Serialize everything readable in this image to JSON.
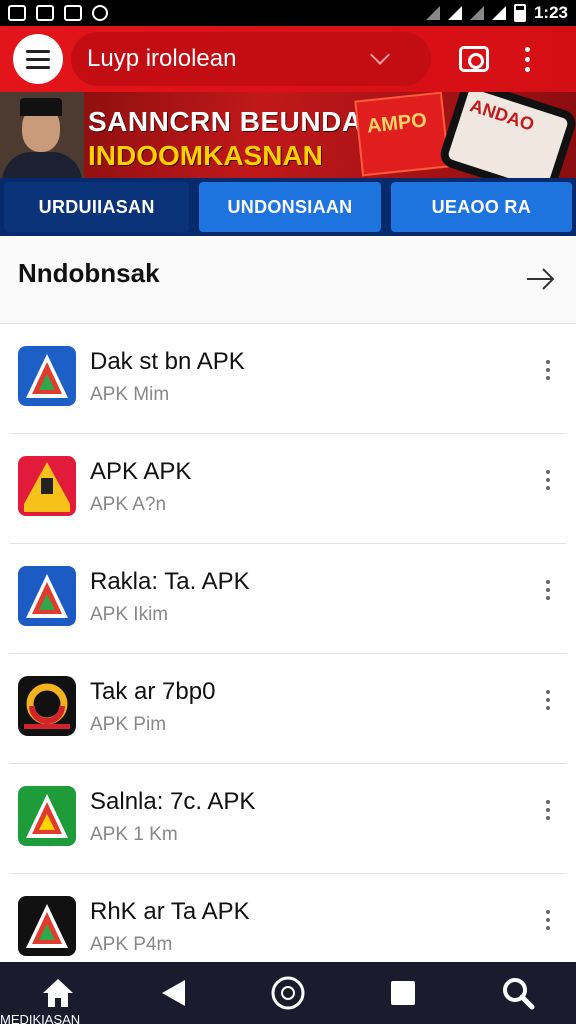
{
  "status_bar": {
    "time": "1:23"
  },
  "toolbar": {
    "search_text": "Luyp irololean"
  },
  "banner": {
    "headline": "SANNCRN BEUNDARI",
    "subline": "INDOOMKASNAN",
    "card_text": "AMPO",
    "phone_text": "ANDAO"
  },
  "tabs": [
    {
      "label": "URDUIIASAN"
    },
    {
      "label": "UNDONSIAAN"
    },
    {
      "label": "UEAOO RA"
    }
  ],
  "section": {
    "title": "Nndobnsak"
  },
  "apps": [
    {
      "name": "Dak st bn APK",
      "sub": "APK Mim",
      "icon": "a-triangle-icon",
      "colors": [
        "#1c5fc7",
        "#e23b2e",
        "#2ea84a"
      ]
    },
    {
      "name": "APK APK",
      "sub": "APK A?n",
      "icon": "warning-triangle-icon",
      "colors": [
        "#e31b3a",
        "#f6c21a",
        "#222222"
      ]
    },
    {
      "name": "Rakla: Ta. APK",
      "sub": "APK Ikim",
      "icon": "a-triangle-icon",
      "colors": [
        "#1d5bc4",
        "#e23b2e",
        "#2ea84a"
      ]
    },
    {
      "name": "Tak ar 7bp0",
      "sub": "APK Pim",
      "icon": "circle-logo-icon",
      "colors": [
        "#111111",
        "#f4b21c",
        "#d2232a"
      ]
    },
    {
      "name": "Salnla: 7c. APK",
      "sub": "APK 1 Km",
      "icon": "a-triangle-icon",
      "colors": [
        "#1e9c3a",
        "#e23b2e",
        "#ffd200"
      ]
    },
    {
      "name": "RhK ar Ta APK",
      "sub": "APK P4m",
      "icon": "a-triangle-icon",
      "colors": [
        "#111111",
        "#e23b2e",
        "#2ea84a"
      ]
    }
  ],
  "bottom_nav": {
    "home_label": "MEDIKIASAN",
    "items": [
      "home-icon",
      "back-icon",
      "circle-icon",
      "square-icon",
      "search-icon"
    ]
  },
  "colors": {
    "primary_red": "#e3141a",
    "tab_blue": "#1e74df",
    "nav_dark": "#1a1c2e"
  }
}
